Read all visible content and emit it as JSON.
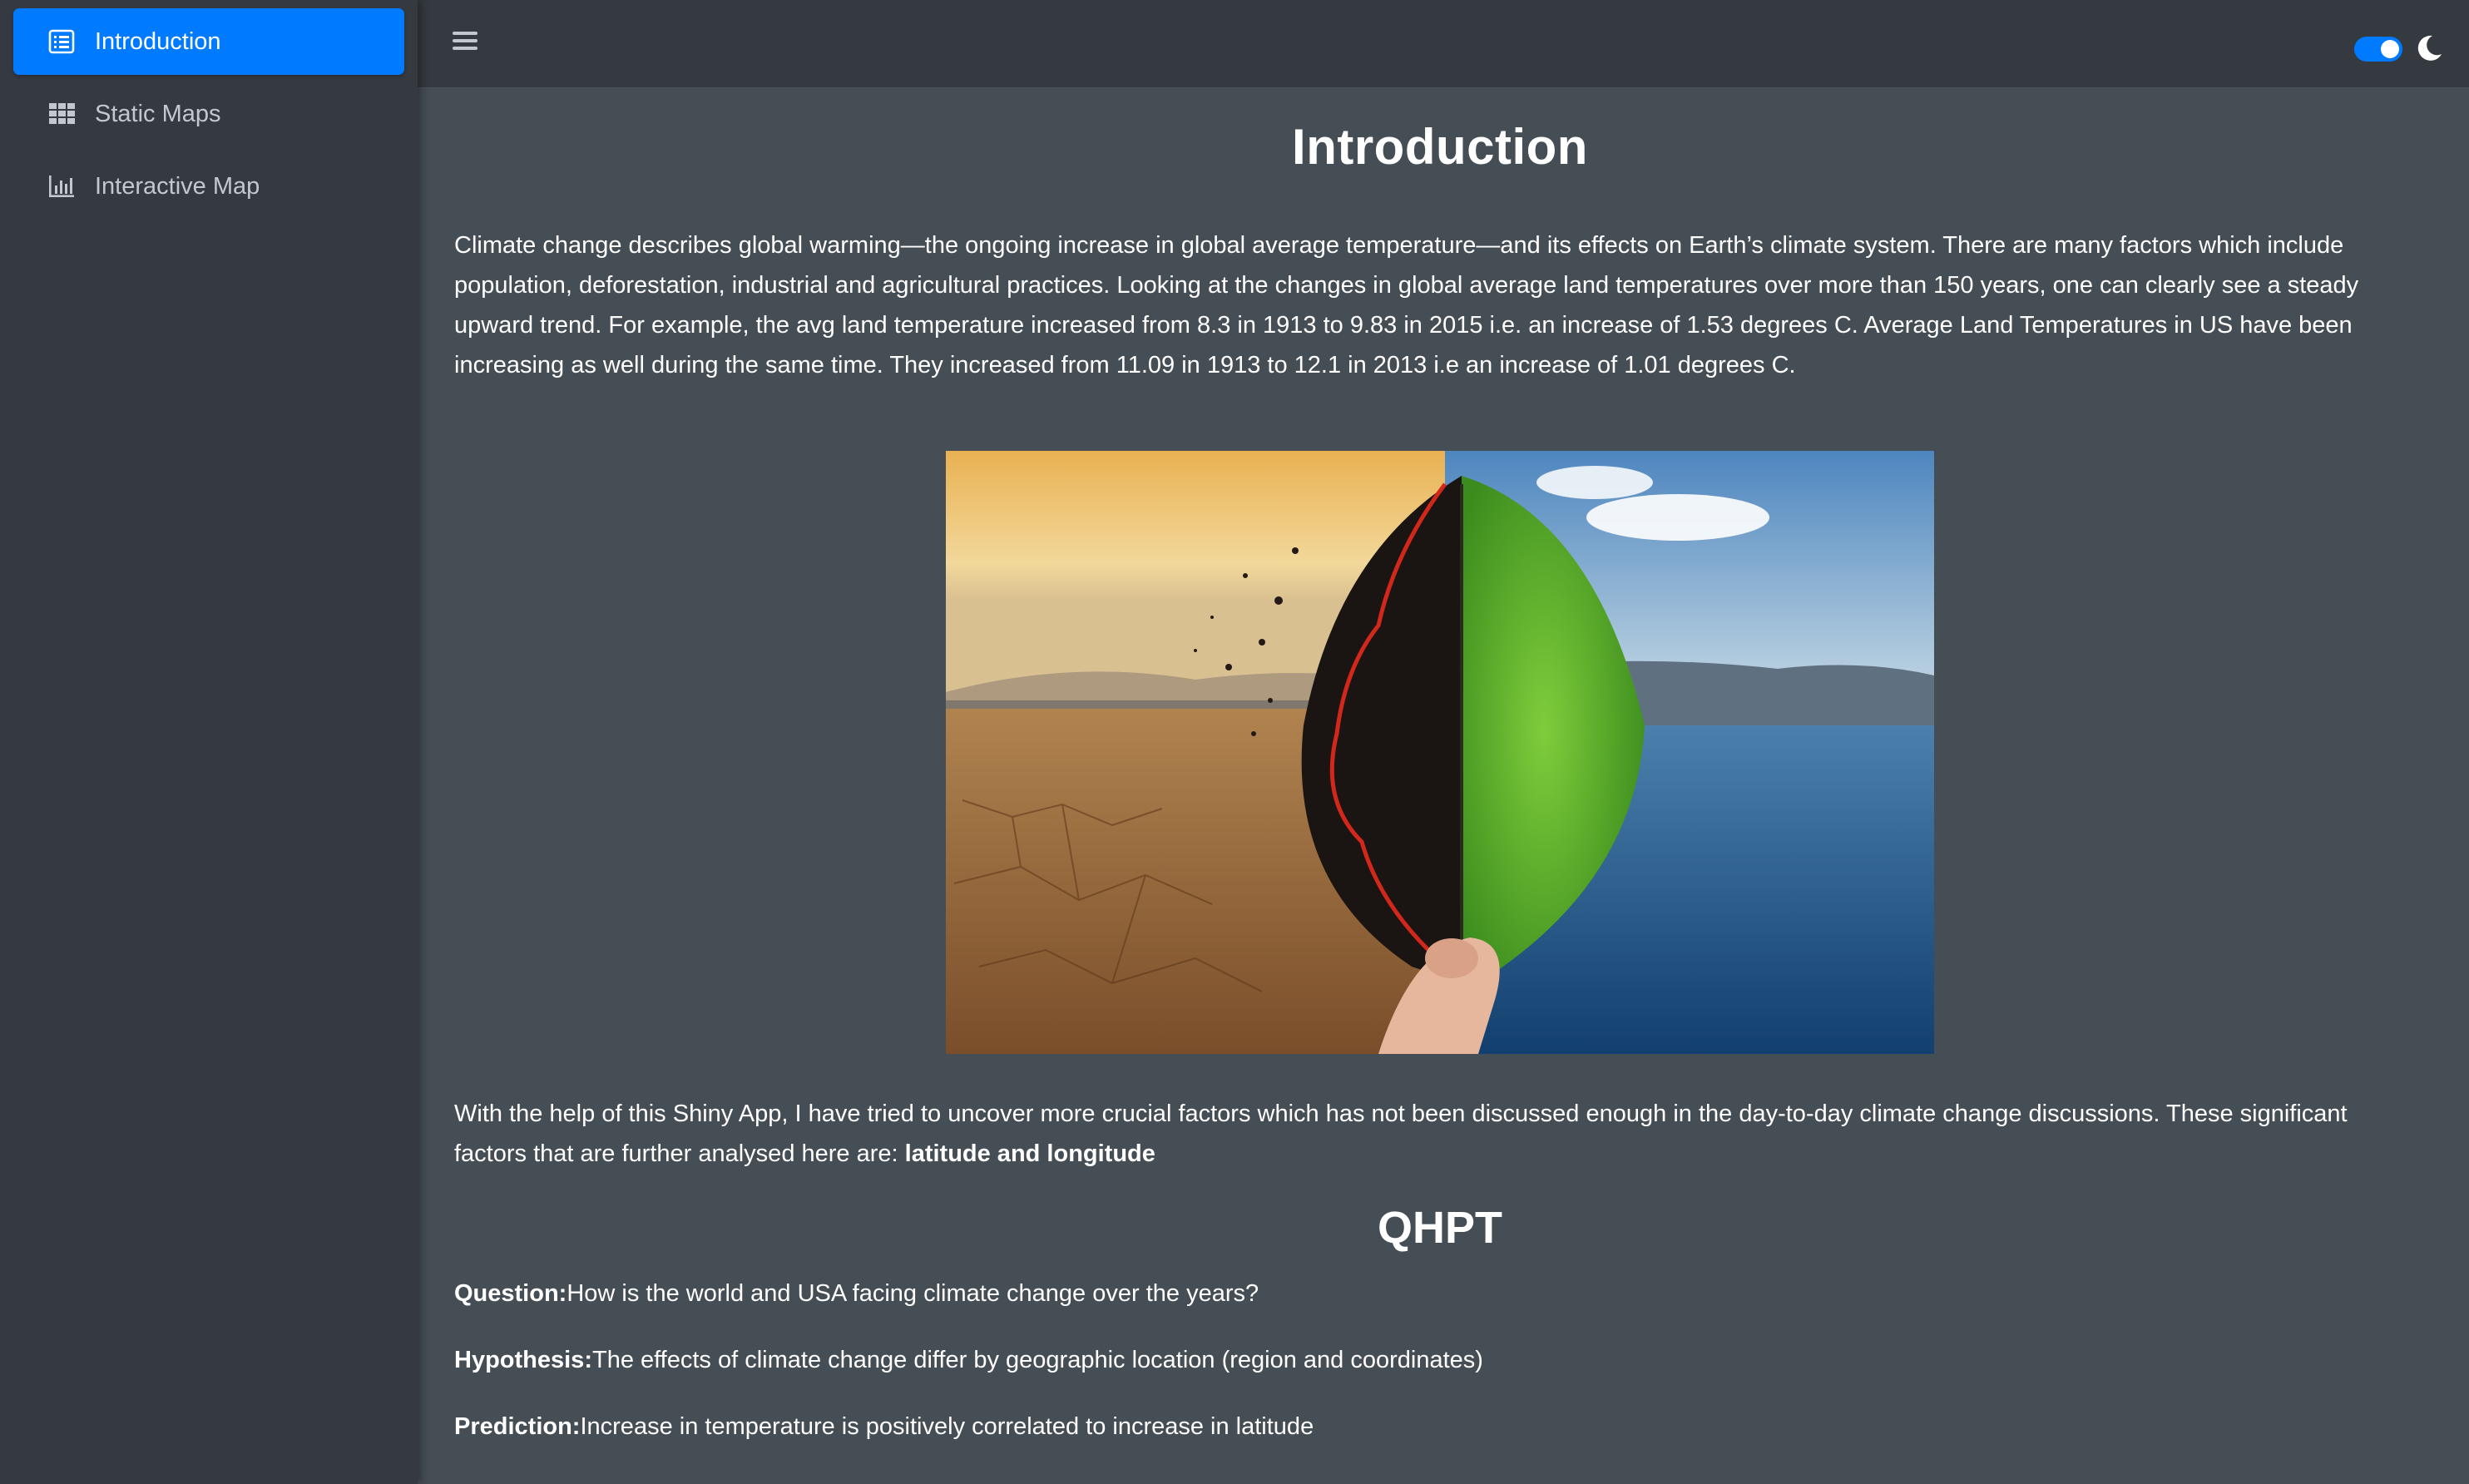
{
  "sidebar": {
    "items": [
      {
        "label": "Introduction",
        "icon": "list-alt-icon",
        "active": true
      },
      {
        "label": "Static Maps",
        "icon": "grid-icon",
        "active": false
      },
      {
        "label": "Interactive Map",
        "icon": "bar-chart-icon",
        "active": false
      }
    ]
  },
  "topbar": {
    "menu_icon": "hamburger-icon",
    "dark_mode_icon": "moon-icon",
    "dark_mode_on": true
  },
  "main": {
    "title": "Introduction",
    "intro_paragraph": "Climate change describes global warming—the ongoing increase in global average temperature—and its effects on Earth’s climate system. There are many factors which include population, deforestation, industrial and agricultural practices. Looking at the changes in global average land temperatures over more than 150 years, one can clearly see a steady upward trend. For example, the avg land temperature increased from 8.3 in 1913 to 9.83 in 2015 i.e. an increase of 1.53 degrees C. Average Land Temperatures in US have been increasing as well during the same time. They increased from 11.09 in 1913 to 12.1 in 2013 i.e an increase of 1.01 degrees C.",
    "after_paragraph_text": "With the help of this Shiny App, I have tried to uncover more crucial factors which has not been discussed enough in the day-to-day climate change discussions. These significant factors that are further analysed here are: ",
    "after_paragraph_bold": "latitude and longitude",
    "qhpt_title": "QHPT",
    "question_label": "Question:",
    "question_text": "How is the world and USA facing climate change over the years?",
    "hypothesis_label": "Hypothesis:",
    "hypothesis_text": "The effects of climate change differ by geographic location (region and coordinates)",
    "prediction_label": "Prediction:",
    "prediction_text": "Increase in temperature is positively correlated to increase in latitude"
  },
  "colors": {
    "accent": "#007bff",
    "sidebar_bg": "#343a40",
    "content_bg": "#454d55",
    "nav_text": "#c2c7d0"
  }
}
